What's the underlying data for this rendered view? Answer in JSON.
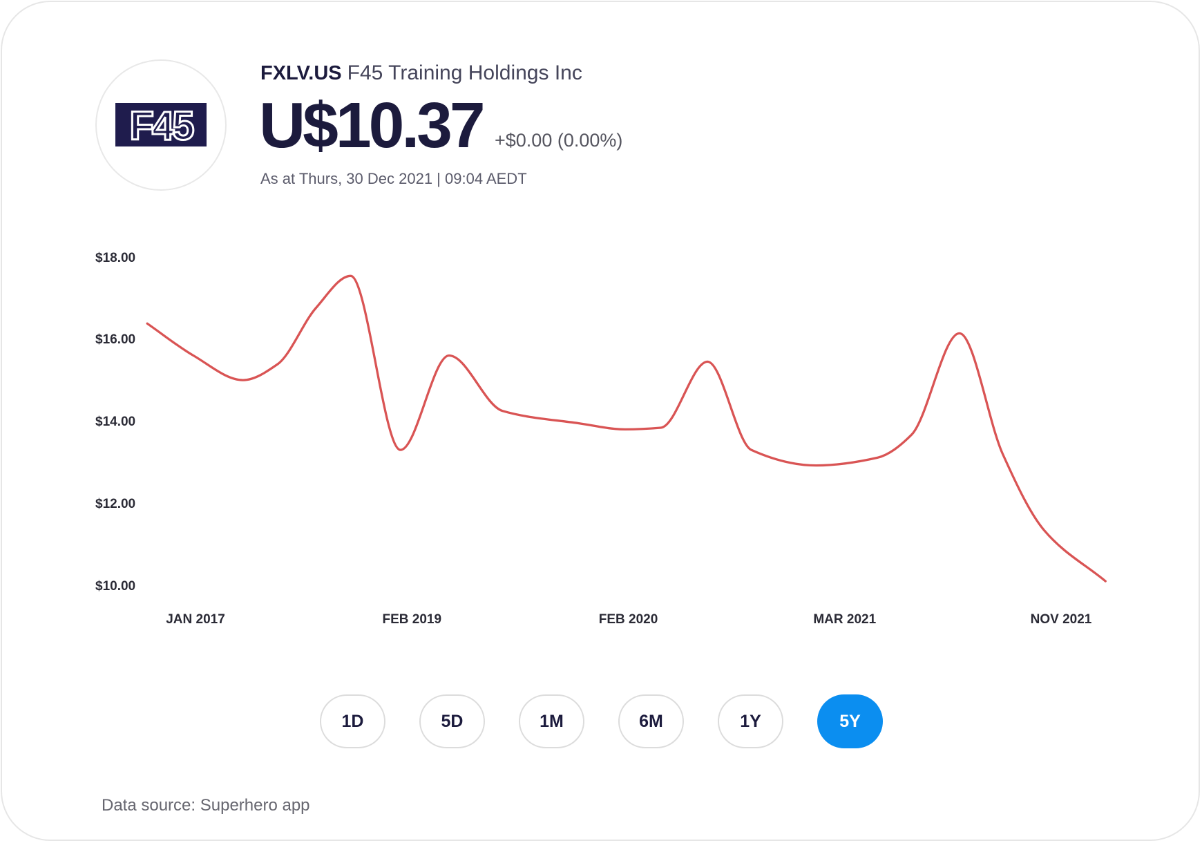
{
  "stock": {
    "logo_text": "F45",
    "ticker": "FXLV.US",
    "name": "F45 Training Holdings Inc",
    "price": "U$10.37",
    "change": "+$0.00 (0.00%)",
    "as_at": "As at Thurs, 30 Dec 2021 | 09:04 AEDT"
  },
  "range_selector": {
    "options": [
      "1D",
      "5D",
      "1M",
      "6M",
      "1Y",
      "5Y"
    ],
    "selected": "5Y"
  },
  "footer": {
    "source": "Data source: Superhero app"
  },
  "colors": {
    "line": "#d95454",
    "accent": "#0b8ef0",
    "text_dark": "#1c1b3d",
    "logo_navy": "#1f1c4d"
  },
  "chart_data": {
    "type": "line",
    "x": [
      "2016-07-16",
      "2016-12-26",
      "2017-06-18",
      "2017-10-18",
      "2018-03-01",
      "2018-07-01",
      "2018-12-24",
      "2019-04-04",
      "2019-07-03",
      "2019-11-09",
      "2020-01-27",
      "2020-04-01",
      "2020-06-25",
      "2020-09-14",
      "2021-01-11",
      "2021-04-08",
      "2021-05-16",
      "2021-07-09",
      "2021-08-27",
      "2021-10-13",
      "2021-12-21"
    ],
    "series": [
      {
        "values": [
          16.39,
          15.61,
          15.01,
          15.4,
          16.77,
          17.55,
          13.31,
          15.61,
          14.26,
          13.96,
          13.81,
          13.85,
          15.46,
          13.31,
          12.93,
          13.12,
          13.68,
          16.15,
          13.21,
          11.35,
          10.11
        ],
        "color": "#d95454"
      }
    ],
    "x_ticks": [
      {
        "label": "JAN 2017",
        "value": "2017-01"
      },
      {
        "label": "FEB 2019",
        "value": "2019-02"
      },
      {
        "label": "FEB 2020",
        "value": "2020-02"
      },
      {
        "label": "MAR 2021",
        "value": "2021-03"
      },
      {
        "label": "NOV 2021",
        "value": "2021-11"
      }
    ],
    "y_ticks": [
      {
        "label": "$18.00",
        "value": 18
      },
      {
        "label": "$16.00",
        "value": 16
      },
      {
        "label": "$14.00",
        "value": 14
      },
      {
        "label": "$12.00",
        "value": 12
      },
      {
        "label": "$10.00",
        "value": 10
      }
    ],
    "ylim": [
      10,
      18
    ],
    "grid": false,
    "legend": false
  }
}
